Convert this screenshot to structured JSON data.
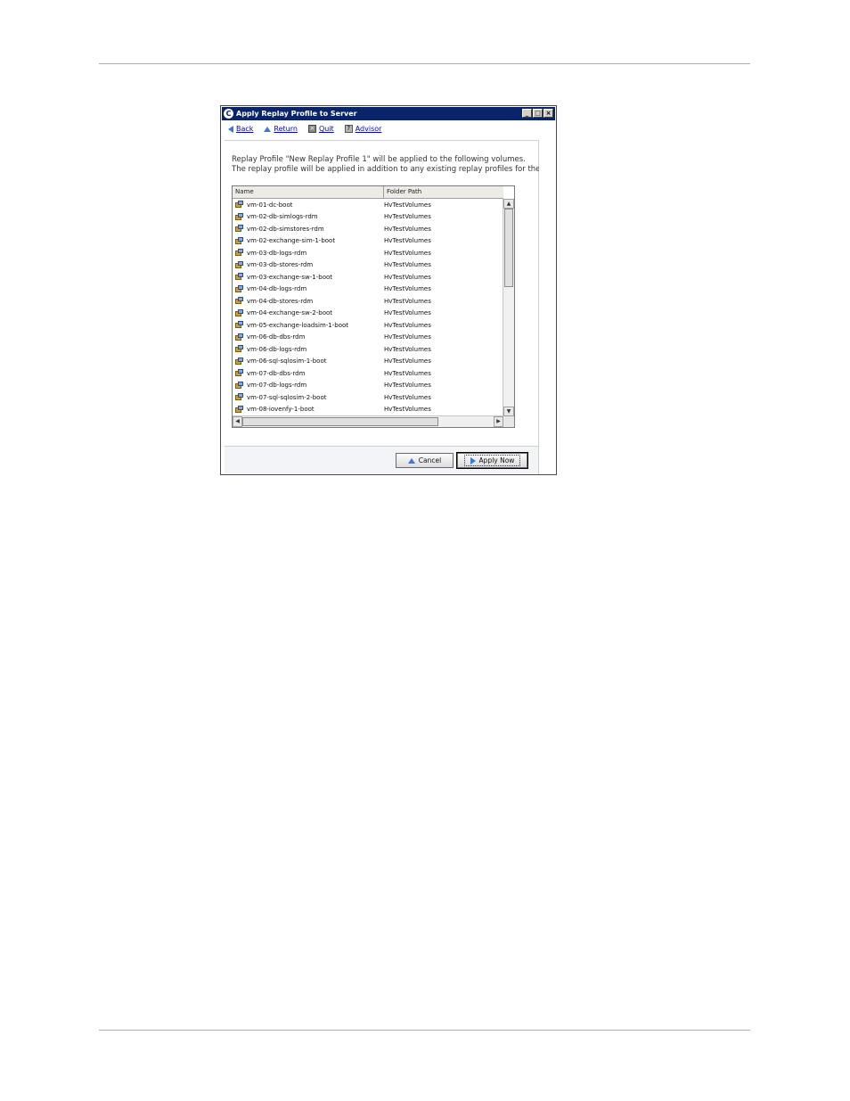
{
  "window": {
    "title": "Apply Replay Profile to Server",
    "controls": [
      "minimize-icon",
      "maximize-icon",
      "close-icon"
    ]
  },
  "toolbar": {
    "back": "Back",
    "return": "Return",
    "quit": "Quit",
    "advisor": "Advisor"
  },
  "message": {
    "line1": "Replay Profile \"New Replay Profile 1\" will be applied to the following volumes.",
    "line2": "The replay profile will be applied in addition to any existing replay profiles for the"
  },
  "table": {
    "columns": [
      "Name",
      "Folder Path"
    ],
    "rows": [
      {
        "name": "vm-01-dc-boot",
        "path": "HvTestVolumes"
      },
      {
        "name": "vm-02-db-simlogs-rdm",
        "path": "HvTestVolumes"
      },
      {
        "name": "vm-02-db-simstores-rdm",
        "path": "HvTestVolumes"
      },
      {
        "name": "vm-02-exchange-sim-1-boot",
        "path": "HvTestVolumes"
      },
      {
        "name": "vm-03-db-logs-rdm",
        "path": "HvTestVolumes"
      },
      {
        "name": "vm-03-db-stores-rdm",
        "path": "HvTestVolumes"
      },
      {
        "name": "vm-03-exchange-sw-1-boot",
        "path": "HvTestVolumes"
      },
      {
        "name": "vm-04-db-logs-rdm",
        "path": "HvTestVolumes"
      },
      {
        "name": "vm-04-db-stores-rdm",
        "path": "HvTestVolumes"
      },
      {
        "name": "vm-04-exchange-sw-2-boot",
        "path": "HvTestVolumes"
      },
      {
        "name": "vm-05-exchange-loadsim-1-boot",
        "path": "HvTestVolumes"
      },
      {
        "name": "vm-06-db-dbs-rdm",
        "path": "HvTestVolumes"
      },
      {
        "name": "vm-06-db-logs-rdm",
        "path": "HvTestVolumes"
      },
      {
        "name": "vm-06-sql-sqlosim-1-boot",
        "path": "HvTestVolumes"
      },
      {
        "name": "vm-07-db-dbs-rdm",
        "path": "HvTestVolumes"
      },
      {
        "name": "vm-07-db-logs-rdm",
        "path": "HvTestVolumes"
      },
      {
        "name": "vm-07-sql-sqlosim-2-boot",
        "path": "HvTestVolumes"
      },
      {
        "name": "vm-08-iovenfy-1-boot",
        "path": "HvTestVolumes"
      }
    ]
  },
  "buttons": {
    "cancel": "Cancel",
    "apply": "Apply Now"
  }
}
